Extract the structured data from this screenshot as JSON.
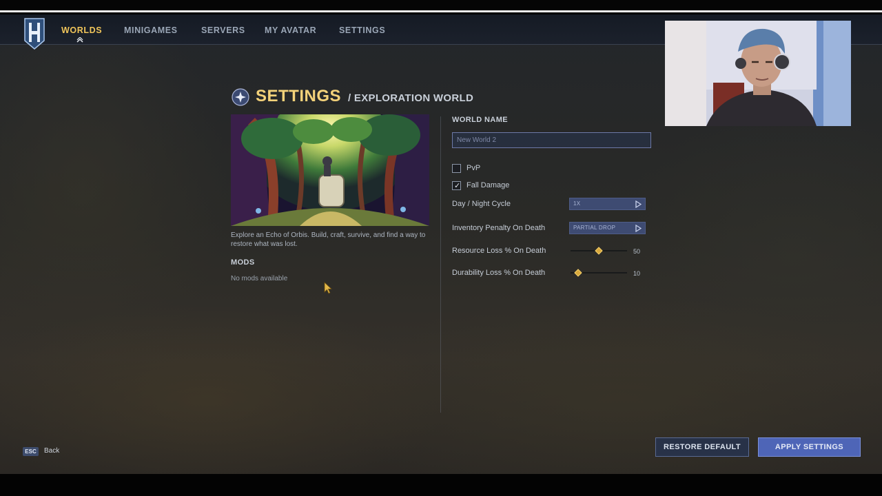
{
  "os_bar": {
    "text": ""
  },
  "nav": {
    "items": [
      {
        "label": "WORLDS",
        "active": true
      },
      {
        "label": "MINIGAMES",
        "active": false
      },
      {
        "label": "SERVERS",
        "active": false
      },
      {
        "label": "MY AVATAR",
        "active": false
      },
      {
        "label": "SETTINGS",
        "active": false
      }
    ]
  },
  "page": {
    "title": "SETTINGS",
    "subtitle": "/ EXPLORATION WORLD",
    "description": "Explore an Echo of Orbis. Build, craft, survive, and find a way to restore what was lost.",
    "mods_heading": "MODS",
    "mods_empty": "No mods available"
  },
  "form": {
    "world_name_label": "WORLD NAME",
    "world_name_placeholder": "New World 2",
    "world_name_value": "",
    "pvp": {
      "label": "PvP",
      "checked": false
    },
    "fall_damage": {
      "label": "Fall Damage",
      "checked": true
    },
    "day_night": {
      "label": "Day / Night Cycle",
      "value": "1X"
    },
    "inventory_penalty": {
      "label": "Inventory Penalty On Death",
      "value": "PARTIAL DROP"
    },
    "resource_loss": {
      "label": "Resource Loss % On Death",
      "value": "50",
      "fraction": 0.5
    },
    "durability_loss": {
      "label": "Durability Loss % On Death",
      "value": "10",
      "fraction": 0.1
    }
  },
  "footer": {
    "esc_key": "ESC",
    "back_label": "Back",
    "restore_label": "RESTORE DEFAULT",
    "apply_label": "APPLY SETTINGS"
  },
  "colors": {
    "accent_gold": "#f0c55a",
    "apply_button": "#4e65b7",
    "dropdown_bg": "#3e4b72",
    "slider_thumb": "#d9a93d"
  },
  "icons": {
    "logo": "hytale-logo",
    "title_icon": "world-badge-icon",
    "dropdown_arrow": "play-arrow-icon",
    "check": "checkmark-icon"
  }
}
